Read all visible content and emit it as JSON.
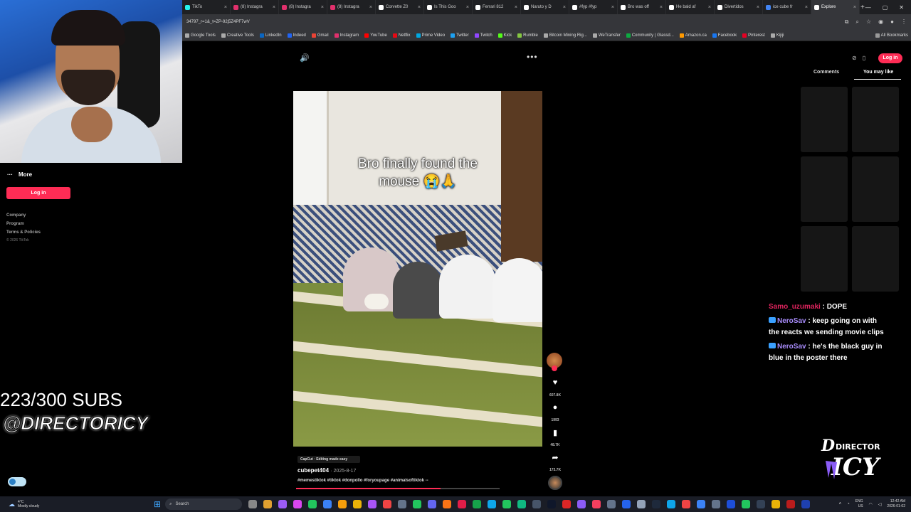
{
  "browser": {
    "tabs": [
      {
        "label": "TikTo",
        "color": "#25f4ee"
      },
      {
        "label": "(8) Instagra",
        "color": "#e1306c"
      },
      {
        "label": "(8) Instagra",
        "color": "#e1306c"
      },
      {
        "label": "(8) Instagra",
        "color": "#e1306c"
      },
      {
        "label": "Corvette Z0",
        "color": "#ffffff"
      },
      {
        "label": "Is This Goo",
        "color": "#ffffff"
      },
      {
        "label": "Ferrari 812",
        "color": "#ffffff"
      },
      {
        "label": "Naruto y D",
        "color": "#ffffff"
      },
      {
        "label": "#fyp #fyp",
        "color": "#ffffff"
      },
      {
        "label": "Bro was off",
        "color": "#ffffff"
      },
      {
        "label": "He bald af",
        "color": "#ffffff"
      },
      {
        "label": "Divertidos",
        "color": "#ffffff"
      },
      {
        "label": "ice cube fr",
        "color": "#4285f4"
      },
      {
        "label": "Explore",
        "color": "#ffffff"
      }
    ],
    "url": "34797_r=1&_t=ZP-92j5Z4PF7wV",
    "bookmarks": [
      {
        "label": "Google Tools",
        "color": "#aaaaaa"
      },
      {
        "label": "Creative Tools",
        "color": "#aaaaaa"
      },
      {
        "label": "LinkedIn",
        "color": "#0a66c2"
      },
      {
        "label": "Indeed",
        "color": "#2164f3"
      },
      {
        "label": "Gmail",
        "color": "#ea4335"
      },
      {
        "label": "Instagram",
        "color": "#e1306c"
      },
      {
        "label": "YouTube",
        "color": "#ff0000"
      },
      {
        "label": "Netflix",
        "color": "#e50914"
      },
      {
        "label": "Prime Video",
        "color": "#00a8e1"
      },
      {
        "label": "Twitter",
        "color": "#1da1f2"
      },
      {
        "label": "Twitch",
        "color": "#9146ff"
      },
      {
        "label": "Kick",
        "color": "#53fc18"
      },
      {
        "label": "Rumble",
        "color": "#85c742"
      },
      {
        "label": "Bitcoin Mining Rig...",
        "color": "#aaaaaa"
      },
      {
        "label": "WeTransfer",
        "color": "#aaaaaa"
      },
      {
        "label": "Community | Glassd...",
        "color": "#0caa41"
      },
      {
        "label": "Amazon.ca",
        "color": "#ff9900"
      },
      {
        "label": "Facebook",
        "color": "#1877f2"
      },
      {
        "label": "Pinterest",
        "color": "#e60023"
      },
      {
        "label": "Kijiji",
        "color": "#aaaaaa"
      }
    ],
    "all_bookmarks": "All Bookmarks"
  },
  "sidebar": {
    "more": "More",
    "login": "Log in",
    "links": [
      "Company",
      "Program",
      "Terms & Policies"
    ],
    "copyright": "© 2026 TikTok"
  },
  "overlay": {
    "subs": "223/300 SUBS",
    "handle": "@DIRECTORICY"
  },
  "video": {
    "caption_line1": "Bro finally found the",
    "caption_line2": "mouse 😭🙏",
    "capcut": "CapCut · Editing made easy",
    "author": "cubepet404",
    "date": "· 2025-8-17",
    "hashtags": "#memestiktok #tiktok #donpollo #foryoupage #animalsoftiktok --",
    "progress": 0.71
  },
  "actions": {
    "likes": "607.8K",
    "comments": "1993",
    "saves": "48.7K",
    "shares": "173.7K"
  },
  "right_panel": {
    "login": "Log in",
    "tab_comments": "Comments",
    "tab_you_may_like": "You may like"
  },
  "chat": [
    {
      "user": "Samo_uzumaki",
      "text": ": DOPE",
      "color": "red"
    },
    {
      "user": "NeroSav",
      "text": ": keep going on with",
      "text2": "the reacts we sending movie clips",
      "color": "purple"
    },
    {
      "user": "NeroSav",
      "text": ": he's the black guy in",
      "text2": "blue in the poster there",
      "color": "purple"
    }
  ],
  "logo": {
    "line1": "DIRECTOR",
    "line2": "ICY"
  },
  "taskbar": {
    "temp": "4°C",
    "weather": "Mostly cloudy",
    "search": "Search",
    "lang1": "ENG",
    "lang2": "US",
    "time": "12:42 AM",
    "date": "2026-01-02"
  }
}
